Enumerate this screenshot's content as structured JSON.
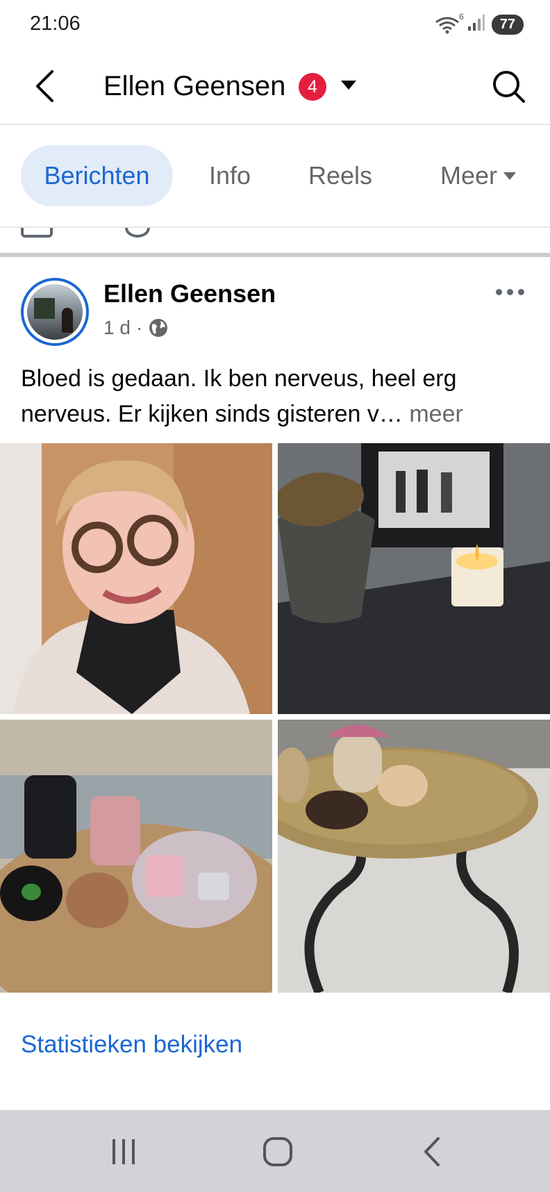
{
  "status_bar": {
    "time": "21:06",
    "wifi_badge": "6",
    "battery": "77"
  },
  "header": {
    "title": "Ellen Geensen",
    "notification_count": "4"
  },
  "tabs": [
    {
      "label": "Berichten",
      "active": true
    },
    {
      "label": "Info",
      "active": false
    },
    {
      "label": "Reels",
      "active": false
    },
    {
      "label": "Meer",
      "active": false
    }
  ],
  "post": {
    "author": "Ellen Geensen",
    "time": "1 d",
    "meta_separator": "·",
    "text": "Bloed is gedaan. Ik ben nerveus, heel erg nerveus. Er kijken sinds gisteren v…",
    "more_label": "meer",
    "photos": [
      {
        "icon": "photo-selfie-woman-glasses"
      },
      {
        "icon": "photo-plant-candle-frame"
      },
      {
        "icon": "photo-candles-coasters-tray"
      },
      {
        "icon": "photo-coffee-table-rug"
      }
    ]
  },
  "footer": {
    "stats_link": "Statistieken bekijken"
  },
  "colors": {
    "accent": "#1b67d3",
    "tab_active_bg": "#e2ebf8",
    "badge": "#e41e3f",
    "nav_bar": "#d1d3d8"
  }
}
